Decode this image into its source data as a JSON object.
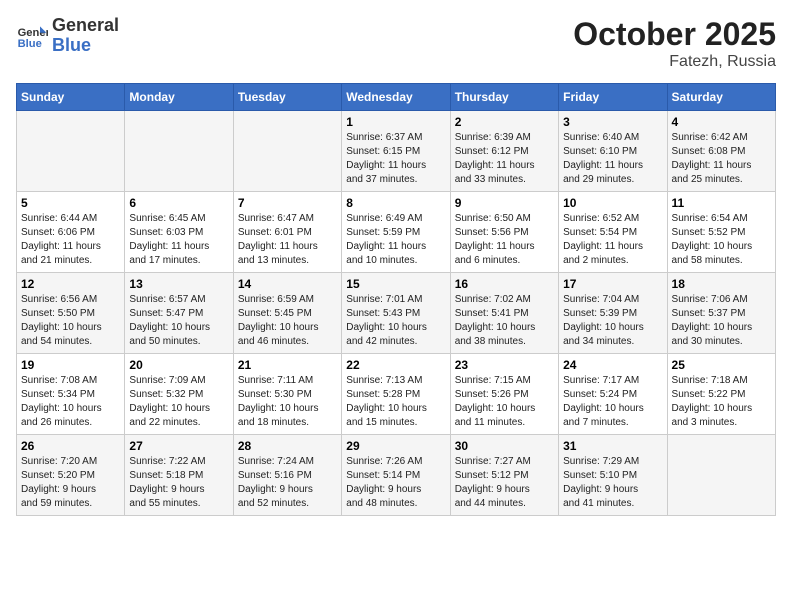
{
  "header": {
    "logo_line1": "General",
    "logo_line2": "Blue",
    "month": "October 2025",
    "location": "Fatezh, Russia"
  },
  "days_of_week": [
    "Sunday",
    "Monday",
    "Tuesday",
    "Wednesday",
    "Thursday",
    "Friday",
    "Saturday"
  ],
  "weeks": [
    [
      {
        "day": "",
        "content": ""
      },
      {
        "day": "",
        "content": ""
      },
      {
        "day": "",
        "content": ""
      },
      {
        "day": "1",
        "content": "Sunrise: 6:37 AM\nSunset: 6:15 PM\nDaylight: 11 hours\nand 37 minutes."
      },
      {
        "day": "2",
        "content": "Sunrise: 6:39 AM\nSunset: 6:12 PM\nDaylight: 11 hours\nand 33 minutes."
      },
      {
        "day": "3",
        "content": "Sunrise: 6:40 AM\nSunset: 6:10 PM\nDaylight: 11 hours\nand 29 minutes."
      },
      {
        "day": "4",
        "content": "Sunrise: 6:42 AM\nSunset: 6:08 PM\nDaylight: 11 hours\nand 25 minutes."
      }
    ],
    [
      {
        "day": "5",
        "content": "Sunrise: 6:44 AM\nSunset: 6:06 PM\nDaylight: 11 hours\nand 21 minutes."
      },
      {
        "day": "6",
        "content": "Sunrise: 6:45 AM\nSunset: 6:03 PM\nDaylight: 11 hours\nand 17 minutes."
      },
      {
        "day": "7",
        "content": "Sunrise: 6:47 AM\nSunset: 6:01 PM\nDaylight: 11 hours\nand 13 minutes."
      },
      {
        "day": "8",
        "content": "Sunrise: 6:49 AM\nSunset: 5:59 PM\nDaylight: 11 hours\nand 10 minutes."
      },
      {
        "day": "9",
        "content": "Sunrise: 6:50 AM\nSunset: 5:56 PM\nDaylight: 11 hours\nand 6 minutes."
      },
      {
        "day": "10",
        "content": "Sunrise: 6:52 AM\nSunset: 5:54 PM\nDaylight: 11 hours\nand 2 minutes."
      },
      {
        "day": "11",
        "content": "Sunrise: 6:54 AM\nSunset: 5:52 PM\nDaylight: 10 hours\nand 58 minutes."
      }
    ],
    [
      {
        "day": "12",
        "content": "Sunrise: 6:56 AM\nSunset: 5:50 PM\nDaylight: 10 hours\nand 54 minutes."
      },
      {
        "day": "13",
        "content": "Sunrise: 6:57 AM\nSunset: 5:47 PM\nDaylight: 10 hours\nand 50 minutes."
      },
      {
        "day": "14",
        "content": "Sunrise: 6:59 AM\nSunset: 5:45 PM\nDaylight: 10 hours\nand 46 minutes."
      },
      {
        "day": "15",
        "content": "Sunrise: 7:01 AM\nSunset: 5:43 PM\nDaylight: 10 hours\nand 42 minutes."
      },
      {
        "day": "16",
        "content": "Sunrise: 7:02 AM\nSunset: 5:41 PM\nDaylight: 10 hours\nand 38 minutes."
      },
      {
        "day": "17",
        "content": "Sunrise: 7:04 AM\nSunset: 5:39 PM\nDaylight: 10 hours\nand 34 minutes."
      },
      {
        "day": "18",
        "content": "Sunrise: 7:06 AM\nSunset: 5:37 PM\nDaylight: 10 hours\nand 30 minutes."
      }
    ],
    [
      {
        "day": "19",
        "content": "Sunrise: 7:08 AM\nSunset: 5:34 PM\nDaylight: 10 hours\nand 26 minutes."
      },
      {
        "day": "20",
        "content": "Sunrise: 7:09 AM\nSunset: 5:32 PM\nDaylight: 10 hours\nand 22 minutes."
      },
      {
        "day": "21",
        "content": "Sunrise: 7:11 AM\nSunset: 5:30 PM\nDaylight: 10 hours\nand 18 minutes."
      },
      {
        "day": "22",
        "content": "Sunrise: 7:13 AM\nSunset: 5:28 PM\nDaylight: 10 hours\nand 15 minutes."
      },
      {
        "day": "23",
        "content": "Sunrise: 7:15 AM\nSunset: 5:26 PM\nDaylight: 10 hours\nand 11 minutes."
      },
      {
        "day": "24",
        "content": "Sunrise: 7:17 AM\nSunset: 5:24 PM\nDaylight: 10 hours\nand 7 minutes."
      },
      {
        "day": "25",
        "content": "Sunrise: 7:18 AM\nSunset: 5:22 PM\nDaylight: 10 hours\nand 3 minutes."
      }
    ],
    [
      {
        "day": "26",
        "content": "Sunrise: 7:20 AM\nSunset: 5:20 PM\nDaylight: 9 hours\nand 59 minutes."
      },
      {
        "day": "27",
        "content": "Sunrise: 7:22 AM\nSunset: 5:18 PM\nDaylight: 9 hours\nand 55 minutes."
      },
      {
        "day": "28",
        "content": "Sunrise: 7:24 AM\nSunset: 5:16 PM\nDaylight: 9 hours\nand 52 minutes."
      },
      {
        "day": "29",
        "content": "Sunrise: 7:26 AM\nSunset: 5:14 PM\nDaylight: 9 hours\nand 48 minutes."
      },
      {
        "day": "30",
        "content": "Sunrise: 7:27 AM\nSunset: 5:12 PM\nDaylight: 9 hours\nand 44 minutes."
      },
      {
        "day": "31",
        "content": "Sunrise: 7:29 AM\nSunset: 5:10 PM\nDaylight: 9 hours\nand 41 minutes."
      },
      {
        "day": "",
        "content": ""
      }
    ]
  ]
}
